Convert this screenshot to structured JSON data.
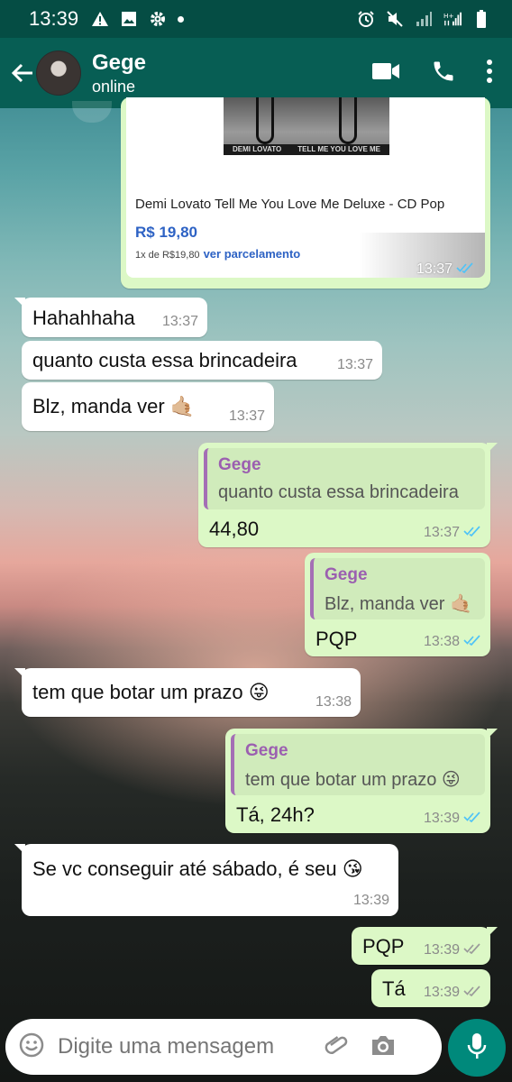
{
  "status_bar": {
    "time": "13:39"
  },
  "header": {
    "contact_name": "Gege",
    "contact_status": "online"
  },
  "link_card": {
    "image_left_text": "DEMI LOVATO",
    "image_right_text": "TELL ME YOU LOVE ME",
    "title": "Demi Lovato Tell Me You Love Me Deluxe - CD Pop",
    "price": "R$ 19,80",
    "installments_prefix": "1x de R$19,80",
    "installments_link": "ver parcelamento",
    "time": "13:37"
  },
  "messages": [
    {
      "dir": "in",
      "text": "Hahahhaha",
      "time": "13:37"
    },
    {
      "dir": "in",
      "text": "quanto custa essa brincadeira",
      "time": "13:37"
    },
    {
      "dir": "in",
      "text": "Blz, manda ver",
      "emoji": "🤙🏼",
      "time": "13:37"
    },
    {
      "dir": "out",
      "quote_name": "Gege",
      "quote_text": "quanto custa essa brincadeira",
      "text": "44,80",
      "time": "13:37"
    },
    {
      "dir": "out",
      "quote_name": "Gege",
      "quote_text": "Blz, manda ver 🤙🏼",
      "text": "PQP",
      "time": "13:38"
    },
    {
      "dir": "in",
      "text": "tem que botar um prazo",
      "emoji": "😜",
      "time": "13:38"
    },
    {
      "dir": "out",
      "quote_name": "Gege",
      "quote_text": "tem que botar um prazo 😜",
      "text": "Tá, 24h?",
      "time": "13:39"
    },
    {
      "dir": "in",
      "text": "Se vc conseguir até sábado, é seu",
      "emoji": "😘",
      "time": "13:39"
    },
    {
      "dir": "out",
      "text": "PQP",
      "time": "13:39"
    },
    {
      "dir": "out",
      "text": "Tá",
      "time": "13:39"
    }
  ],
  "input": {
    "placeholder": "Digite uma mensagem"
  },
  "colors": {
    "header": "#075e54",
    "status_bar": "#054d44",
    "outgoing_bubble": "#dcf8c6",
    "incoming_bubble": "#ffffff",
    "read_ticks": "#4fc3f7",
    "quote_name": "#9b5fb0",
    "mic_button": "#00897b"
  },
  "icons": {
    "status_left": [
      "warning-icon",
      "image-icon",
      "settings-icon",
      "dot-icon"
    ],
    "status_right": [
      "alarm-icon",
      "mute-icon",
      "signal-icon",
      "hplus-signal-icon",
      "signal-icon",
      "battery-icon"
    ],
    "header": [
      "back-arrow-icon",
      "video-call-icon",
      "phone-icon",
      "more-icon"
    ],
    "input": [
      "emoji-icon",
      "attach-icon",
      "camera-icon",
      "mic-icon"
    ]
  }
}
